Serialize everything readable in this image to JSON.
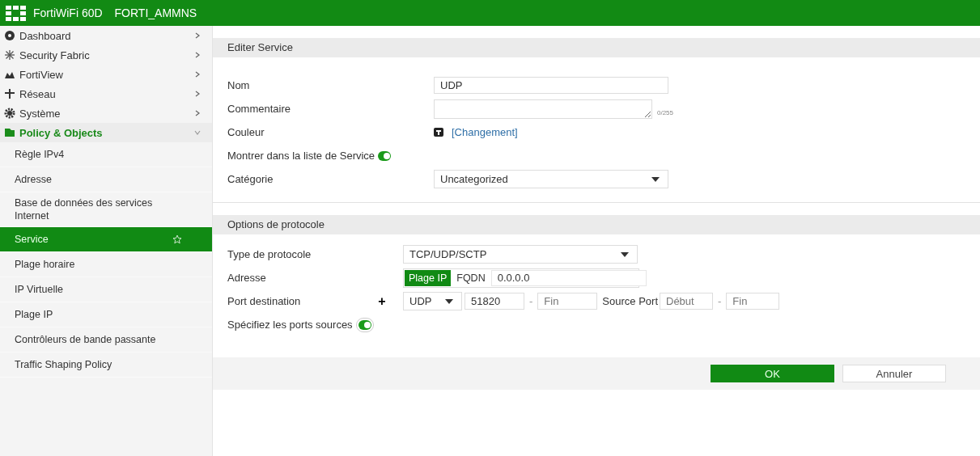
{
  "header": {
    "product": "FortiWiFi 60D",
    "hostname": "FORTI_AMMNS"
  },
  "sidebar": {
    "items": [
      {
        "label": "Dashboard",
        "expanded": false
      },
      {
        "label": "Security Fabric",
        "expanded": false
      },
      {
        "label": "FortiView",
        "expanded": false
      },
      {
        "label": "Réseau",
        "expanded": false
      },
      {
        "label": "Système",
        "expanded": false
      },
      {
        "label": "Policy & Objects",
        "expanded": true,
        "children": [
          {
            "label": "Règle IPv4",
            "selected": false
          },
          {
            "label": "Adresse",
            "selected": false
          },
          {
            "label": "Base de données des services Internet",
            "selected": false
          },
          {
            "label": "Service",
            "selected": true
          },
          {
            "label": "Plage horaire",
            "selected": false
          },
          {
            "label": "IP Virtuelle",
            "selected": false
          },
          {
            "label": "Plage IP",
            "selected": false
          },
          {
            "label": "Contrôleurs de bande passante",
            "selected": false
          },
          {
            "label": "Traffic Shaping Policy",
            "selected": false
          }
        ]
      }
    ]
  },
  "sections": [
    {
      "title": "Editer Service",
      "fields": [
        {
          "kind": "text",
          "label": "Nom",
          "value": "UDP"
        },
        {
          "kind": "textarea",
          "label": "Commentaire",
          "counter": "0/255"
        },
        {
          "kind": "color",
          "label": "Couleur",
          "link": "[Changement]"
        },
        {
          "kind": "toggle",
          "label": "Montrer dans la liste de Service",
          "on": true
        },
        {
          "kind": "select",
          "label": "Catégorie",
          "value": "Uncategorized"
        }
      ]
    },
    {
      "title": "Options de protocole",
      "fields": [
        {
          "kind": "select",
          "label": "Type de protocole",
          "value": "TCP/UDP/SCTP"
        },
        {
          "kind": "address",
          "label": "Adresse",
          "options": [
            {
              "label": "Plage IP",
              "selected": true
            },
            {
              "label": "FQDN",
              "selected": false
            }
          ],
          "value": "0.0.0.0"
        },
        {
          "kind": "ports",
          "label": "Port destination",
          "add": "+",
          "protocol": "UDP",
          "low": "51820",
          "separator": "-",
          "high_placeholder": "Fin",
          "source_label": "Source Port",
          "source_low_placeholder": "Début",
          "source_separator": "-",
          "source_high_placeholder": "Fin"
        },
        {
          "kind": "toggle",
          "label": "Spécifiez les ports sources",
          "on": true,
          "boxed": true
        }
      ]
    }
  ],
  "buttons": [
    {
      "label": "OK",
      "primary": true
    },
    {
      "label": "Annuler",
      "primary": false
    }
  ]
}
